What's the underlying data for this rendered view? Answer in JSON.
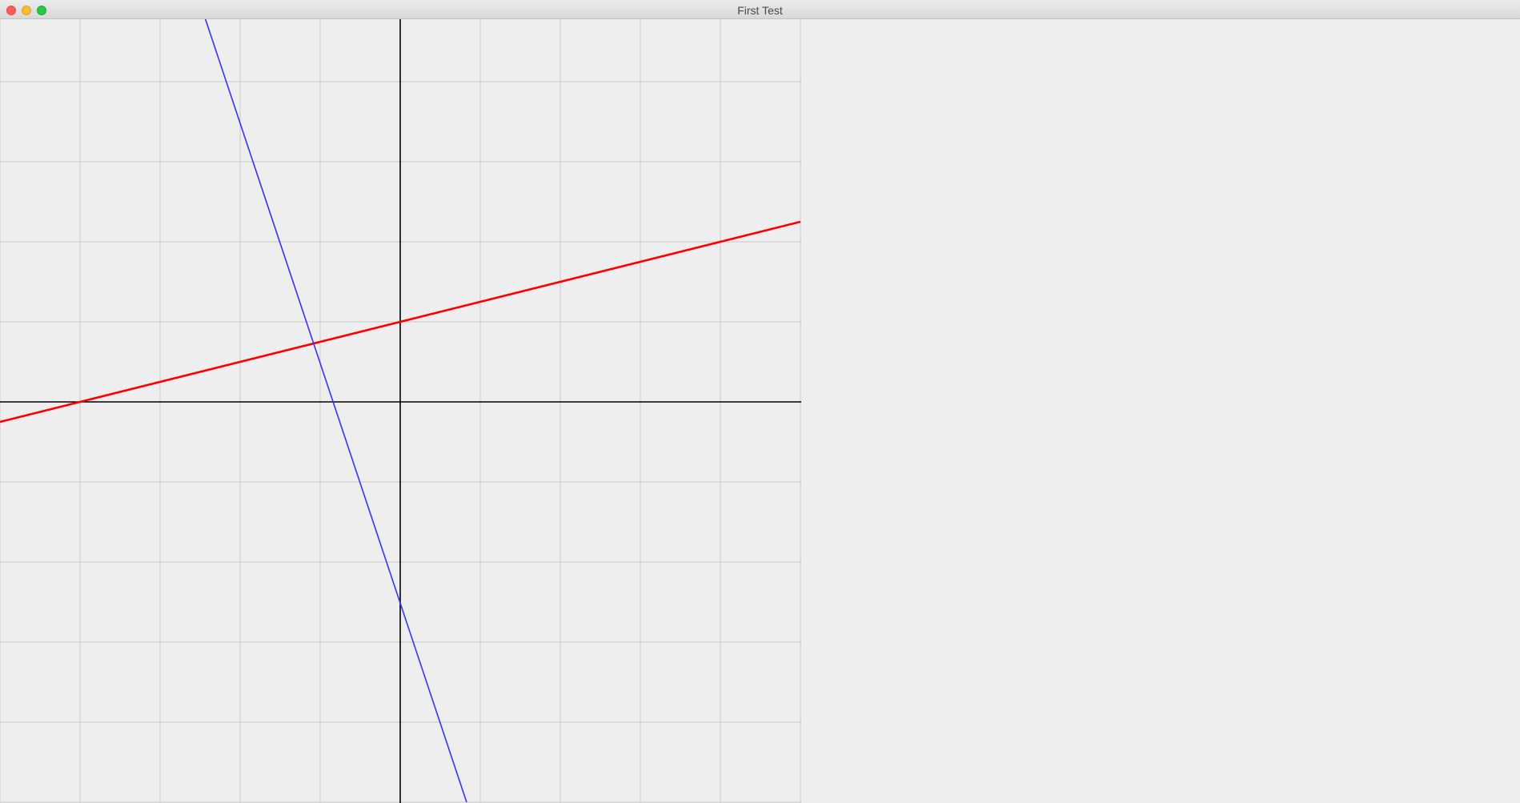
{
  "window": {
    "title": "First Test"
  },
  "chart_data": {
    "type": "line",
    "grid": true,
    "axes_visible": true,
    "xlim": [
      -5,
      5
    ],
    "ylim": [
      -5,
      5
    ],
    "grid_step": 1,
    "series": [
      {
        "color": "#ff0000",
        "x": [
          -5,
          5
        ],
        "y": [
          -0.25,
          2.25
        ]
      },
      {
        "color": "#3333ff",
        "x": [
          -2.44,
          0.83
        ],
        "y": [
          4.8,
          -5.0
        ]
      }
    ],
    "colors": {
      "grid": "#c8c8c8",
      "axis": "#000000",
      "background": "#eeeeee"
    }
  }
}
